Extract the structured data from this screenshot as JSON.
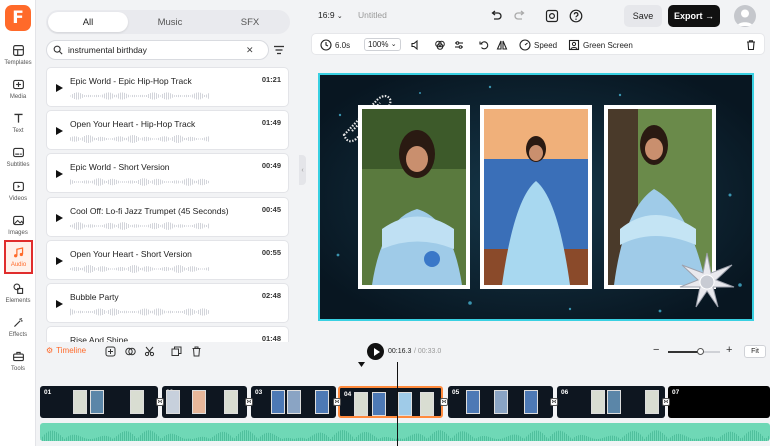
{
  "app": {
    "logo_letter": "F"
  },
  "rail": [
    {
      "label": "Templates",
      "icon": "templates-icon"
    },
    {
      "label": "Media",
      "icon": "media-icon"
    },
    {
      "label": "Text",
      "icon": "text-icon"
    },
    {
      "label": "Subtitles",
      "icon": "subtitles-icon"
    },
    {
      "label": "Videos",
      "icon": "videos-icon"
    },
    {
      "label": "Images",
      "icon": "images-icon"
    },
    {
      "label": "Audio",
      "icon": "audio-icon",
      "active": true
    },
    {
      "label": "Elements",
      "icon": "elements-icon"
    },
    {
      "label": "Effects",
      "icon": "effects-icon"
    },
    {
      "label": "Tools",
      "icon": "tools-icon"
    }
  ],
  "panel": {
    "tabs": [
      "All",
      "Music",
      "SFX"
    ],
    "active_tab": "All",
    "search_value": "instrumental birthday",
    "tracks": [
      {
        "title": "Epic World - Epic Hip-Hop Track",
        "duration": "01:21"
      },
      {
        "title": "Open Your Heart - Hip-Hop Track",
        "duration": "01:49"
      },
      {
        "title": "Epic World - Short Version",
        "duration": "00:49"
      },
      {
        "title": "Cool Off: Lo-fi Jazz Trumpet (45 Seconds)",
        "duration": "00:45"
      },
      {
        "title": "Open Your Heart - Short Version",
        "duration": "00:55"
      },
      {
        "title": "Bubble Party",
        "duration": "02:48"
      },
      {
        "title": "Rise And Shine",
        "duration": "01:48"
      }
    ]
  },
  "topbar": {
    "aspect": "16:9",
    "doc_name": "Untitled",
    "save_label": "Save",
    "export_label": "Export"
  },
  "toolbar": {
    "duration": "6.0s",
    "zoom": "100%",
    "speed_label": "Speed",
    "green_screen_label": "Green Screen"
  },
  "timeline": {
    "label": "Timeline",
    "current_time": "00:16.3",
    "total_time": "/ 00:33.0",
    "fit_label": "Fit",
    "zoom_level": 0.62,
    "clips": [
      "01",
      "02",
      "03",
      "04",
      "05",
      "06",
      "07"
    ],
    "selected_clip": "04"
  },
  "colors": {
    "accent": "#ff6a2a",
    "canvas_bg": "#0b1f2d",
    "selection": "#39d0e2",
    "audio": "#6fd8b6"
  }
}
